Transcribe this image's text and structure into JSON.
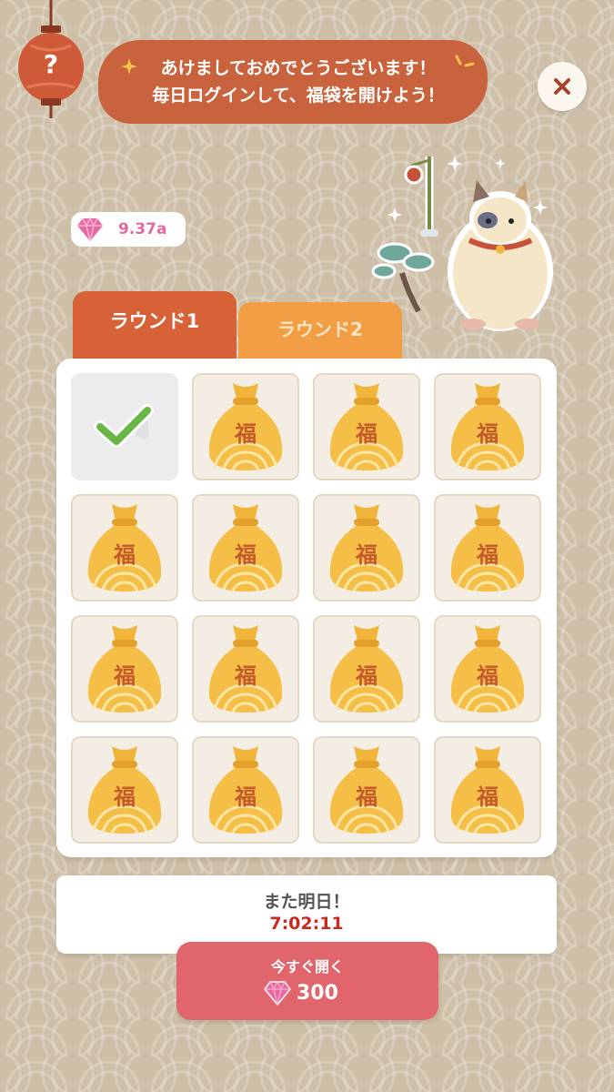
{
  "banner": {
    "line1": "あけましておめでとうございます！",
    "line2": "毎日ログインして、福袋を開けよう！"
  },
  "help": {
    "label": "?"
  },
  "currency": {
    "value": "9.37a",
    "icon": "gem-icon"
  },
  "tabs": [
    {
      "label": "ラウンド1",
      "active": true
    },
    {
      "label": "ラウンド2",
      "active": false
    }
  ],
  "grid": {
    "bag_label": "福",
    "cells": [
      {
        "opened": true
      },
      {
        "opened": false
      },
      {
        "opened": false
      },
      {
        "opened": false
      },
      {
        "opened": false
      },
      {
        "opened": false
      },
      {
        "opened": false
      },
      {
        "opened": false
      },
      {
        "opened": false
      },
      {
        "opened": false
      },
      {
        "opened": false
      },
      {
        "opened": false
      },
      {
        "opened": false
      },
      {
        "opened": false
      },
      {
        "opened": false
      },
      {
        "opened": false
      }
    ]
  },
  "next": {
    "label": "また明日！",
    "timer": "7:02:11"
  },
  "open_now": {
    "label": "今すぐ開く",
    "cost": "300"
  },
  "colors": {
    "background": "#cdbfa8",
    "banner": "#c8633d",
    "tab_active": "#d86238",
    "tab_inactive": "#f29e45",
    "button": "#e0666c",
    "timer": "#c9291f",
    "gem": "#e46a9e"
  }
}
